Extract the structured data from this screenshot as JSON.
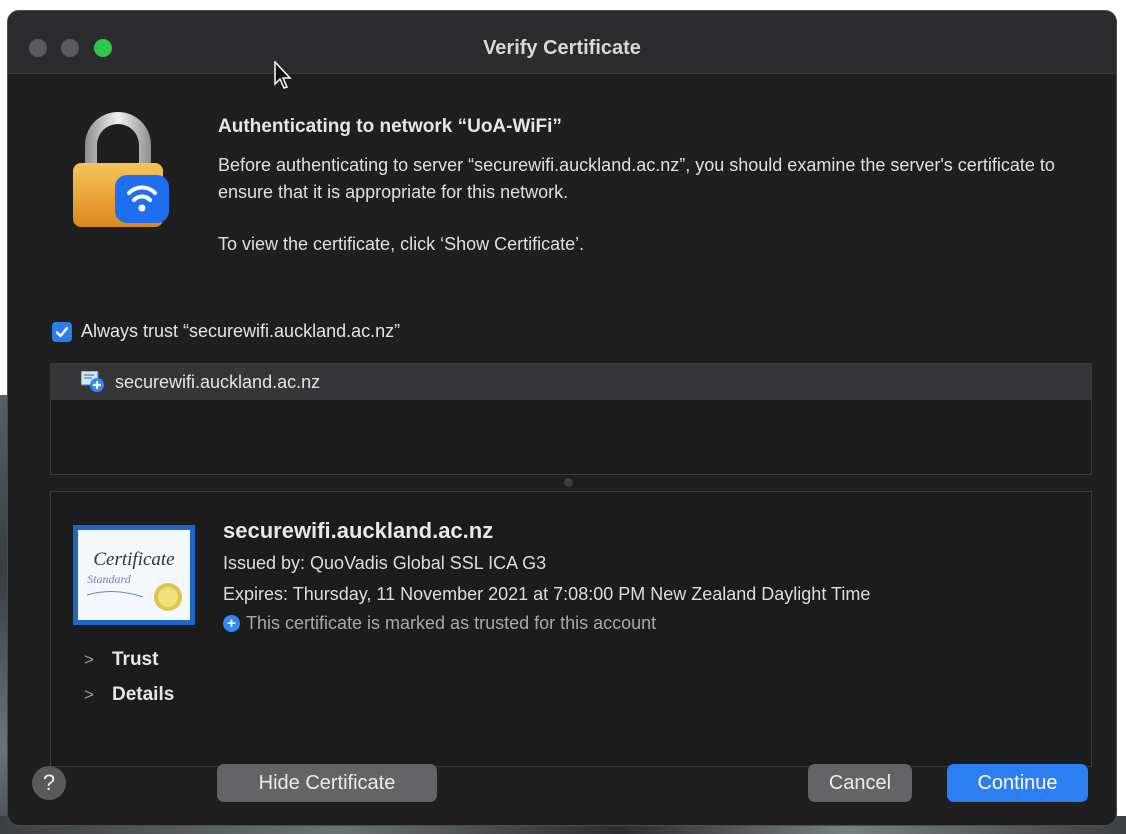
{
  "window": {
    "title": "Verify Certificate"
  },
  "dialog": {
    "heading": "Authenticating to network “UoA-WiFi”",
    "message": "Before authenticating to server “securewifi.auckland.ac.nz”, you should examine the server's certificate to ensure that it is appropriate for this network.",
    "instruction": "To view the certificate, click ‘Show Certificate’."
  },
  "always_trust": {
    "label": "Always trust “securewifi.auckland.ac.nz”",
    "checked": true
  },
  "chain": {
    "items": [
      {
        "label": "securewifi.auckland.ac.nz",
        "icon": "certificate-icon"
      }
    ]
  },
  "certificate": {
    "name": "securewifi.auckland.ac.nz",
    "issued_by": "Issued by: QuoVadis Global SSL ICA G3",
    "expires": "Expires: Thursday, 11 November 2021 at 7:08:00 PM New Zealand Daylight Time",
    "trusted_note": "This certificate is marked as trusted for this account",
    "image_text": {
      "title": "Certificate",
      "subtitle": "Standard"
    }
  },
  "sections": {
    "trust": "Trust",
    "details": "Details"
  },
  "buttons": {
    "help": "?",
    "hide_certificate": "Hide Certificate",
    "cancel": "Cancel",
    "continue": "Continue"
  },
  "colors": {
    "accent": "#2b7ff2",
    "zoom_button": "#2ec94a"
  }
}
